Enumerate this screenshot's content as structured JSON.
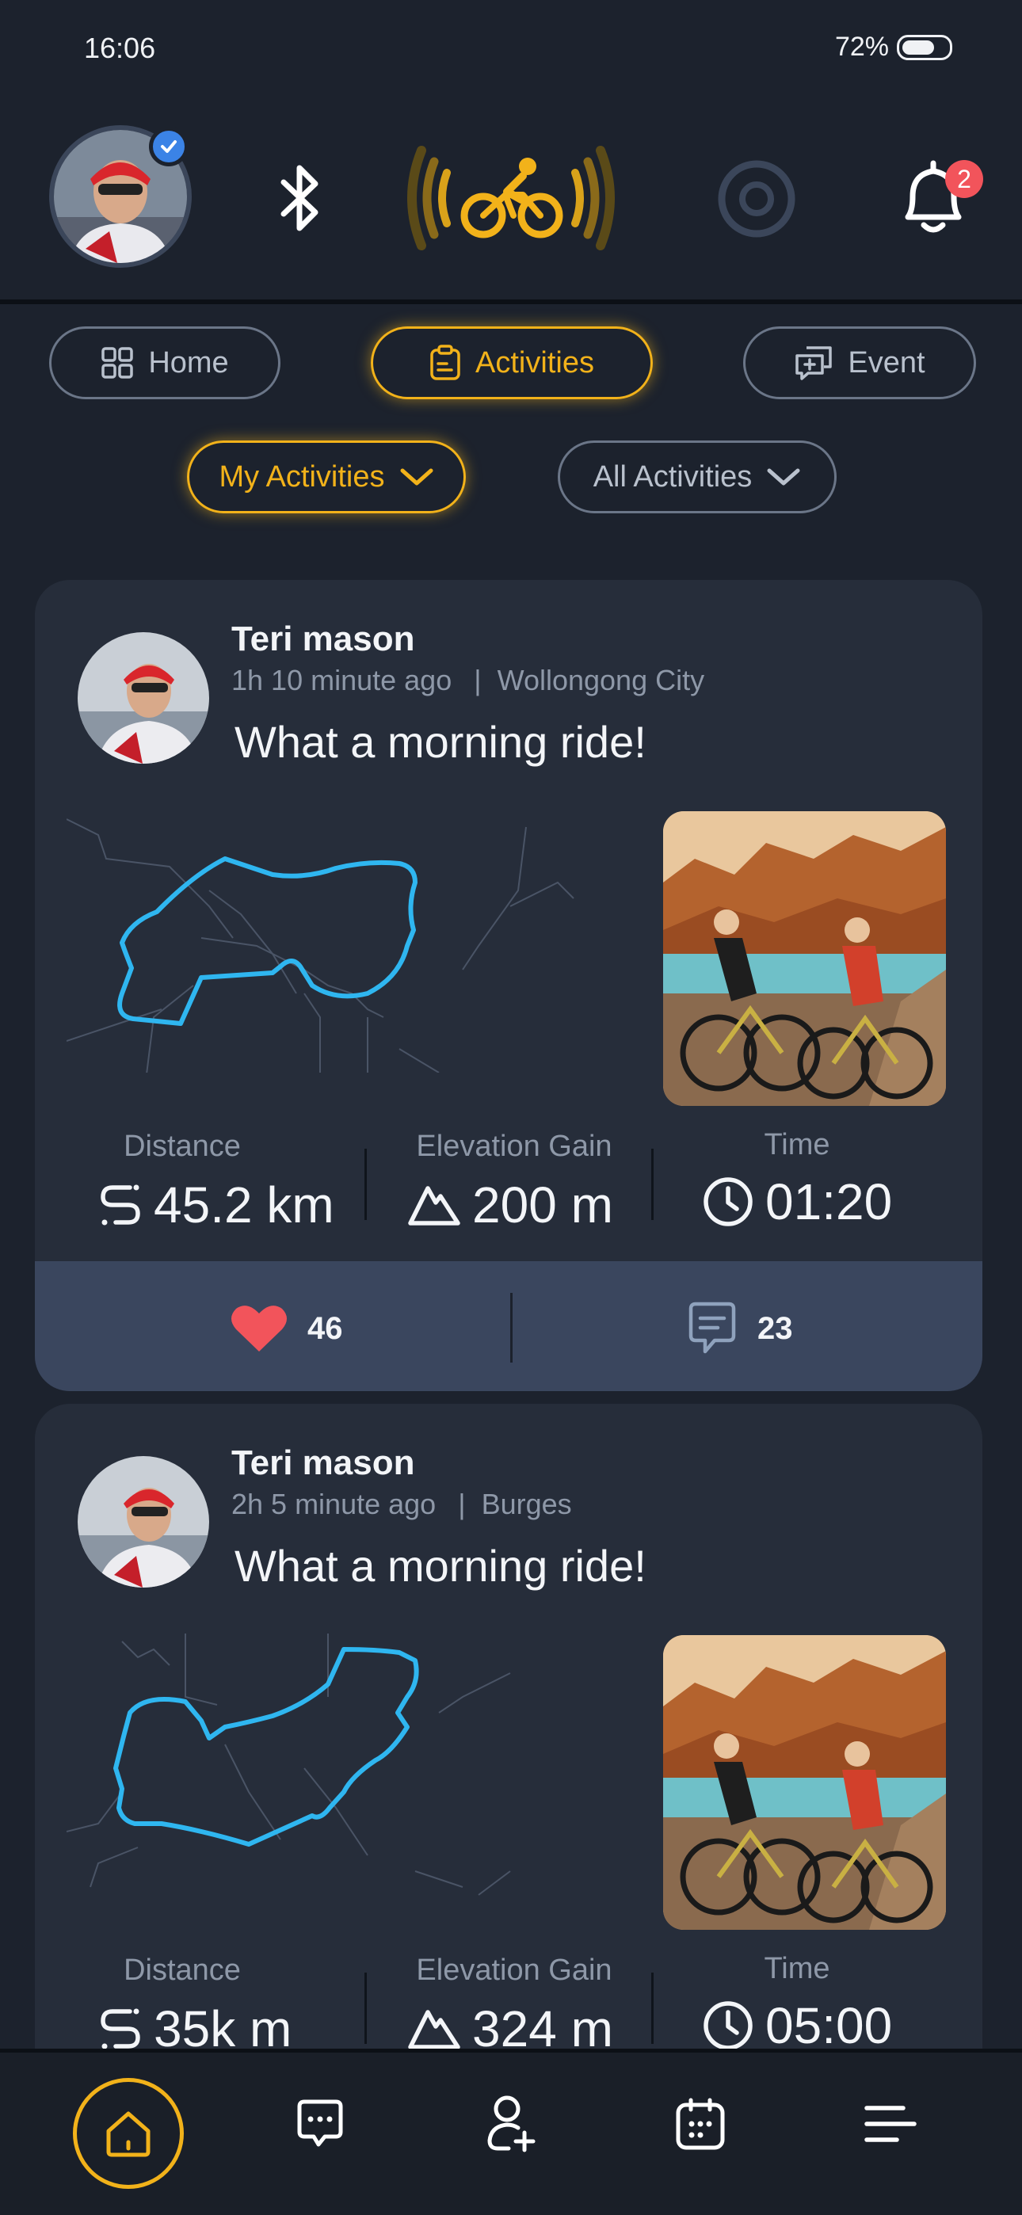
{
  "status": {
    "time": "16:06",
    "battery": "72%",
    "battery_level": 0.72
  },
  "header": {
    "notification_count": "2",
    "icons": [
      "avatar",
      "bluetooth-icon",
      "cycling-sensor-icon",
      "sensor-ring-icon",
      "bell-icon"
    ]
  },
  "tabs": [
    {
      "label": "Home",
      "icon": "grid-icon",
      "active": false
    },
    {
      "label": "Activities",
      "icon": "clipboard-icon",
      "active": true
    },
    {
      "label": "Event",
      "icon": "event-icon",
      "active": false
    }
  ],
  "filters": [
    {
      "label": "My Activities",
      "active": true
    },
    {
      "label": "All Activities",
      "active": false
    }
  ],
  "activities": [
    {
      "name": "Teri mason",
      "time_ago": "1h 10 minute ago",
      "location": "Wollongong City",
      "title": "What a morning ride!",
      "distance_label": "Distance",
      "distance": "45.2 km",
      "elevation_label": "Elevation Gain",
      "elevation": "200 m",
      "time_label": "Time",
      "time": "01:20",
      "likes": "46",
      "comments": "23"
    },
    {
      "name": "Teri mason",
      "time_ago": "2h 5 minute ago",
      "location": "Burges",
      "title": "What a morning ride!",
      "distance_label": "Distance",
      "distance": "35k m",
      "elevation_label": "Elevation Gain",
      "elevation": "324 m",
      "time_label": "Time",
      "time": "05:00"
    }
  ],
  "nav": [
    "home-icon",
    "chat-icon",
    "add-user-icon",
    "calendar-icon",
    "menu-icon"
  ],
  "colors": {
    "accent": "#f2b21a",
    "route": "#2fb6f0",
    "heart": "#f2545b",
    "card": "#262d3a",
    "footer": "#3a465e"
  }
}
